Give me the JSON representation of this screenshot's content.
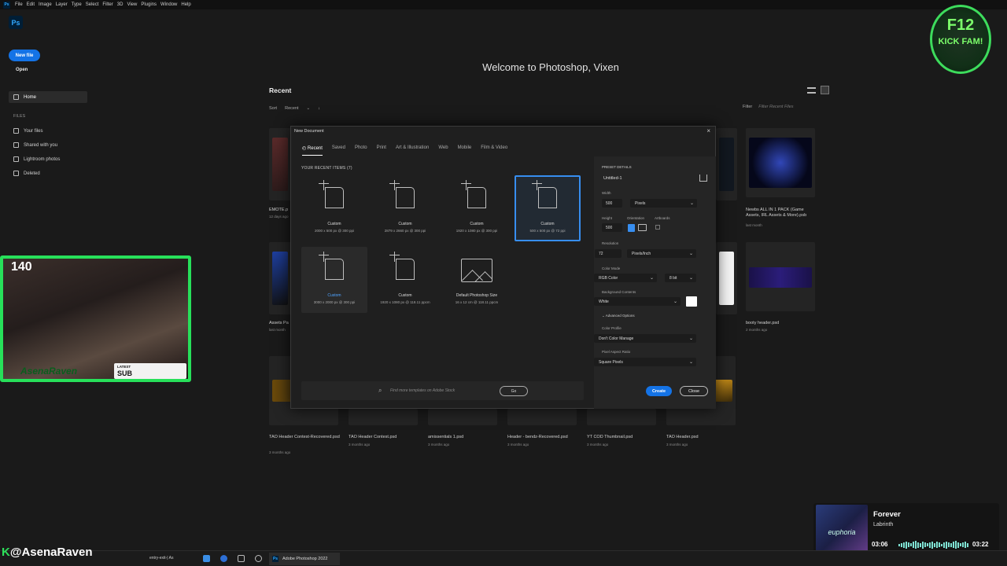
{
  "menubar": {
    "app_badge": "Ps",
    "items": [
      "File",
      "Edit",
      "Image",
      "Layer",
      "Type",
      "Select",
      "Filter",
      "3D",
      "View",
      "Plugins",
      "Window",
      "Help"
    ]
  },
  "sidebar": {
    "logo": "Ps",
    "new_file": "New file",
    "open": "Open",
    "home": "Home",
    "files_label": "FILES",
    "items": [
      {
        "label": "Your files",
        "icon": "file-icon"
      },
      {
        "label": "Shared with you",
        "icon": "people-icon"
      },
      {
        "label": "Lightroom photos",
        "icon": "lightroom-icon"
      },
      {
        "label": "Deleted",
        "icon": "trash-icon"
      }
    ]
  },
  "home": {
    "welcome": "Welcome to Photoshop, Vixen",
    "recent_title": "Recent",
    "sort_label": "Sort",
    "sort_value": "Recent",
    "sort_arrow": "↓",
    "filter_label": "Filter",
    "filter_placeholder": "Filter Recent Files",
    "files": [
      {
        "name": "EMOTE.p",
        "date": "12 days ago"
      },
      {
        "name": "Newbs ALL IN 1 PACK (Game Assets, IRL Assets & More).psb",
        "date": "last month"
      },
      {
        "name": "Assets Pa",
        "date": "last month"
      },
      {
        "name": "booty header.psd",
        "date": "2 months ago"
      },
      {
        "name": "TAO Header Contest-Recovered.psd",
        "date": "3 months ago"
      },
      {
        "name": "TAO Header Contest.psd",
        "date": "3 months ago"
      },
      {
        "name": "amissentials 1.psd",
        "date": "3 months ago"
      },
      {
        "name": "Header - bendz-Recovered.psd",
        "date": "3 months ago"
      },
      {
        "name": "YT COD Thumbnail.psd",
        "date": "3 months ago"
      },
      {
        "name": "TAO Header.psd",
        "date": "3 months ago"
      }
    ]
  },
  "dialog": {
    "title": "New Document",
    "tabs": [
      "Recent",
      "Saved",
      "Photo",
      "Print",
      "Art & Illustration",
      "Web",
      "Mobile",
      "Film & Video"
    ],
    "recent_label": "YOUR RECENT ITEMS",
    "recent_count": "(7)",
    "items": [
      {
        "name": "Custom",
        "size": "2000 x 500 px @ 300 ppi"
      },
      {
        "name": "Custom",
        "size": "2879 x 2660 px @ 300 ppi"
      },
      {
        "name": "Custom",
        "size": "1920 x 1080 px @ 300 ppi"
      },
      {
        "name": "Custom",
        "size": "500 x 500 px @ 72 ppi"
      },
      {
        "name": "Custom",
        "size": "3000 x 2000 px @ 300 ppi"
      },
      {
        "name": "Custom",
        "size": "1920 x 1080 px @ 118.11 ppcm"
      },
      {
        "name": "Default Photoshop Size",
        "size": "16 x 12 cm @ 118.11 ppcm"
      }
    ],
    "search_placeholder": "Find more templates on Adobe Stock",
    "go": "Go",
    "preset": {
      "heading": "PRESET DETAILS",
      "name": "Untitled-1",
      "width_label": "Width",
      "width": "500",
      "width_unit": "Pixels",
      "height_label": "Height",
      "height": "500",
      "orientation_label": "Orientation",
      "artboards_label": "Artboards",
      "resolution_label": "Resolution",
      "resolution": "72",
      "resolution_unit": "Pixels/Inch",
      "color_mode_label": "Color Mode",
      "color_mode": "RGB Color",
      "bit_depth": "8 bit",
      "bg_label": "Background Contents",
      "bg_value": "White",
      "advanced": "Advanced Options",
      "profile_label": "Color Profile",
      "profile": "Don't Color Manage",
      "par_label": "Pixel Aspect Ratio",
      "par": "Square Pixels"
    },
    "create": "Create",
    "close": "Close"
  },
  "stream": {
    "sub_count": "140",
    "latest_label": "LATEST",
    "latest_value": "SUB",
    "webcam_name": "AsenaRaven",
    "handle": "@AsenaRaven",
    "badge_line1": "F12",
    "badge_line2": "KICK FAM!"
  },
  "music": {
    "album_text": "euphoria",
    "song": "Forever",
    "artist": "Labrinth",
    "elapsed": "03:06",
    "total": "03:22",
    "progress": 0.92
  },
  "taskbar": {
    "window_title": "Adobe Photoshop 2022",
    "snippet": "entry-exit-| As"
  },
  "colors": {
    "accent": "#1473e6",
    "stream_green": "#27e05a",
    "music_teal": "#7fe3d4"
  }
}
